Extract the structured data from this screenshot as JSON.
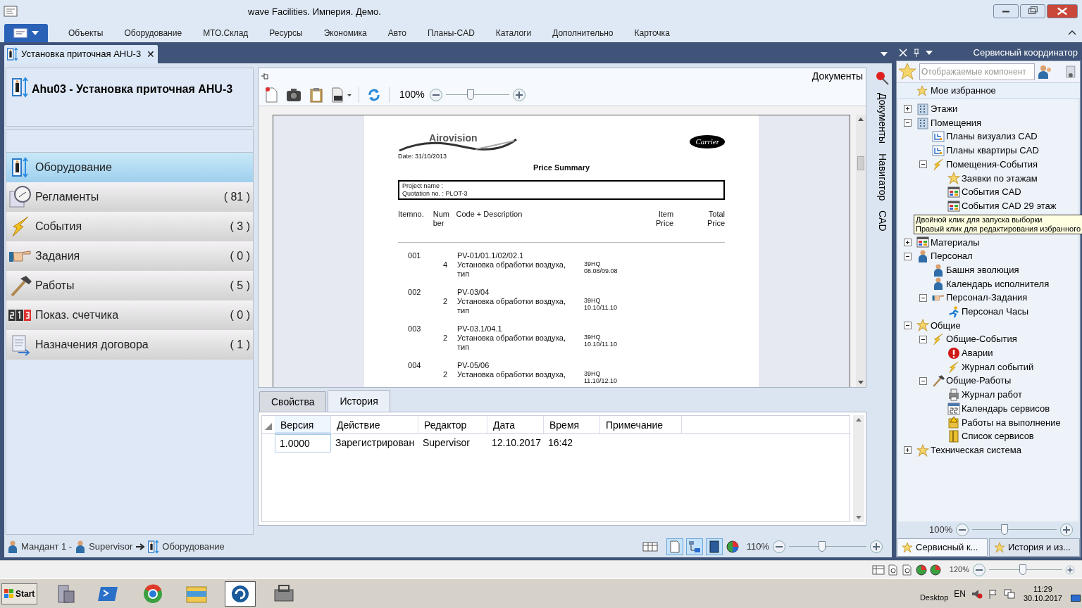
{
  "window": {
    "title": "wave Facilities. Империя. Демо."
  },
  "menu": {
    "items": [
      "Объекты",
      "Оборудование",
      "МТО.Склад",
      "Ресурсы",
      "Экономика",
      "Авто",
      "Планы-CAD",
      "Каталоги",
      "Дополнительно",
      "Карточка"
    ]
  },
  "doc_tab": {
    "label": "Установка приточная AHU-3",
    "close": "✕"
  },
  "left_panel": {
    "title": "Ahu03 - Установка приточная AHU-3",
    "items": [
      {
        "label": "Оборудование",
        "selected": true
      },
      {
        "label": "Регламенты",
        "count": "( 81 )",
        "selected": false
      },
      {
        "label": "События",
        "count": "( 3 )",
        "selected": false
      },
      {
        "label": "Задания",
        "count": "( 0 )",
        "selected": false
      },
      {
        "label": "Работы",
        "count": "( 5 )",
        "selected": false
      },
      {
        "label": "Показ. счетчика",
        "count": "( 0 )",
        "selected": false
      },
      {
        "label": "Назначения договора",
        "count": "( 1 )",
        "selected": false
      }
    ]
  },
  "documents": {
    "title": "Документы",
    "zoom": "100%",
    "level": 0.38,
    "page": {
      "logo": "Airovision",
      "brand": "Carrier",
      "date": "Date: 31/10/2013",
      "heading": "Price Summary",
      "project": "Project name :",
      "quotation": "Quotation no. : PLOT-3",
      "columns": [
        "Itemno.",
        "Num ber",
        "Code + Description",
        "Item Price",
        "Total Price"
      ],
      "rows": [
        {
          "itemno": "001",
          "number": "4",
          "code": "PV-01/01.1/02/02.1",
          "description": "Установка обработки воздуха, тип",
          "model": "39HQ",
          "range": "08.08/09.08"
        },
        {
          "itemno": "002",
          "number": "2",
          "code": "PV-03/04",
          "description": "Установка обработки воздуха, тип",
          "model": "39HQ",
          "range": "10.10/11.10"
        },
        {
          "itemno": "003",
          "number": "2",
          "code": "PV-03.1/04.1",
          "description": "Установка обработки воздуха, тип",
          "model": "39HQ",
          "range": "10.10/11.10"
        },
        {
          "itemno": "004",
          "number": "2",
          "code": "PV-05/06",
          "description": "Установка обработки воздуха,",
          "model": "39HQ",
          "range": "11.10/12.10"
        }
      ]
    }
  },
  "side_tabs": [
    "Документы",
    "Навигатор",
    "CAD"
  ],
  "bottom_tabs": [
    {
      "label": "Свойства",
      "selected": false
    },
    {
      "label": "История",
      "selected": true
    }
  ],
  "history": {
    "columns": [
      "Версия",
      "Действие",
      "Редактор",
      "Дата",
      "Время",
      "Примечание"
    ],
    "rows": [
      [
        "1.0000",
        "Зарегистрирован",
        "Supervisor",
        "12.10.2017",
        "16:42",
        ""
      ]
    ]
  },
  "service": {
    "title": "Сервисный координатор",
    "placeholder": "Отображаемые компонент",
    "favorites": "Мое избранное",
    "tree": [
      {
        "label": "Этажи",
        "expanded": false
      },
      {
        "label": "Помещения",
        "expanded": true,
        "children": [
          {
            "label": "Планы визуализ CAD"
          },
          {
            "label": "Планы квартиры CAD"
          },
          {
            "label": "Помещения-События",
            "expanded": true,
            "children": [
              {
                "label": "Заявки по этажам"
              },
              {
                "label": "События CAD"
              },
              {
                "label": "События CAD 29 этаж"
              }
            ]
          }
        ]
      },
      {
        "label": "Материалы",
        "expanded": false
      },
      {
        "label": "Персонал",
        "expanded": true,
        "children": [
          {
            "label": "Башня эволюция"
          },
          {
            "label": "Календарь исполнителя"
          },
          {
            "label": "Персонал-Задания",
            "expanded": true,
            "children": [
              {
                "label": "Персонал Часы"
              }
            ]
          }
        ]
      },
      {
        "label": "Общие",
        "expanded": true,
        "children": [
          {
            "label": "Общие-События",
            "expanded": true,
            "children": [
              {
                "label": "Аварии"
              },
              {
                "label": "Журнал событий"
              }
            ]
          },
          {
            "label": "Общие-Работы",
            "expanded": true,
            "children": [
              {
                "label": "Журнал работ"
              },
              {
                "label": "Календарь сервисов"
              },
              {
                "label": "Работы на выполнение"
              },
              {
                "label": "Список сервисов"
              }
            ]
          }
        ]
      },
      {
        "label": "Техническая система",
        "expanded": false
      }
    ],
    "tooltip": [
      "Двойной клик для запуска выборки",
      "Правый клик для редактирования избранного"
    ],
    "zoom": "100%",
    "level": 0.37,
    "tabs": [
      {
        "label": "Сервисный к...",
        "selected": true
      },
      {
        "label": "История и из...",
        "selected": false
      }
    ]
  },
  "status": {
    "breadcrumb": [
      "Мандант 1 -",
      "Supervisor",
      "Оборудование"
    ],
    "zoom": "110%",
    "level": 0.42
  },
  "lower_bar": {
    "zoom": "120%",
    "level": 0.46
  },
  "taskbar": {
    "start": "Start",
    "desktop": "Desktop",
    "lang": "EN",
    "time": "11:29",
    "date": "30.10.2017"
  }
}
